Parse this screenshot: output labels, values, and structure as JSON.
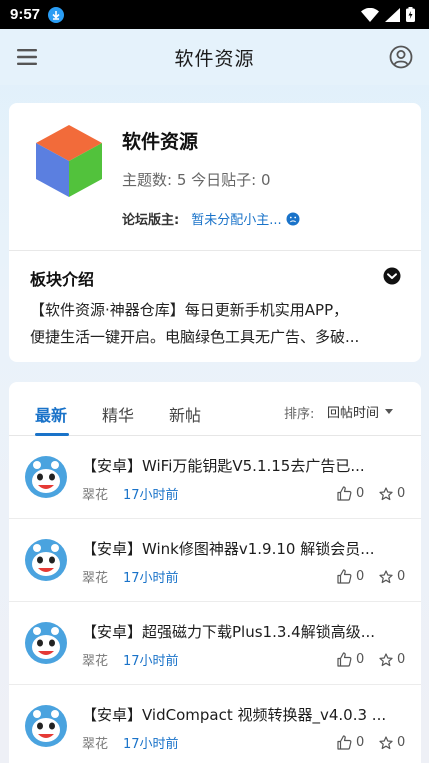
{
  "status_bar": {
    "time": "9:57"
  },
  "header": {
    "title": "软件资源"
  },
  "forum": {
    "name": "软件资源",
    "stats": "主题数: 5 今日贴子: 0",
    "moderator_label": "论坛版主:",
    "moderator_value": "暂未分配小主...",
    "intro_title": "板块介绍",
    "intro_line1": "【软件资源·神器仓库】每日更新手机实用APP，",
    "intro_line2": "便捷生活一键开启。电脑绿色工具无广告、多破..."
  },
  "tabs": [
    "最新",
    "精华",
    "新帖"
  ],
  "sort": {
    "label": "排序:",
    "value": "回帖时间"
  },
  "threads": [
    {
      "title": "【安卓】WiFi万能钥匙V5.1.15去广告已...",
      "author": "翠花",
      "time": "17小时前",
      "likes": "0",
      "favs": "0"
    },
    {
      "title": "【安卓】Wink修图神器v1.9.10 解锁会员...",
      "author": "翠花",
      "time": "17小时前",
      "likes": "0",
      "favs": "0"
    },
    {
      "title": "【安卓】超强磁力下载Plus1.3.4解锁高级...",
      "author": "翠花",
      "time": "17小时前",
      "likes": "0",
      "favs": "0"
    },
    {
      "title": "【安卓】VidCompact 视频转换器_v4.0.3 ...",
      "author": "翠花",
      "time": "17小时前",
      "likes": "0",
      "favs": "0"
    }
  ],
  "icons": {
    "menu": "menu-icon",
    "user": "user-circle-icon",
    "logo": "cube-icon",
    "sad": "sad-face-icon",
    "expand": "chevron-down-circle-icon",
    "like": "thumbs-up-icon",
    "fav": "star-icon"
  },
  "colors": {
    "accent": "#1a73c9",
    "header_bg": "#e5f2fb"
  }
}
